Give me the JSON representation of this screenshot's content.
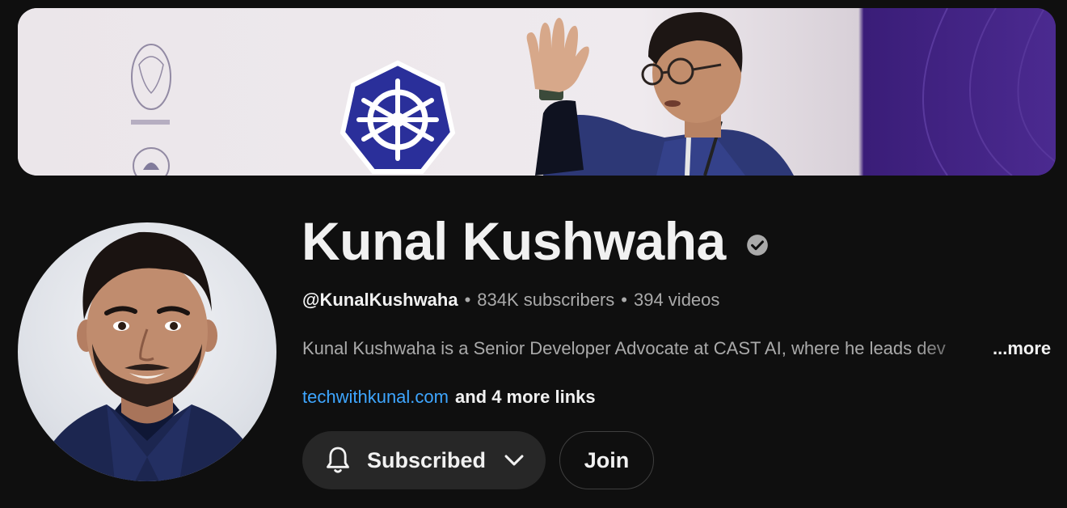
{
  "channel": {
    "name": "Kunal Kushwaha",
    "handle": "@KunalKushwaha",
    "subscribers": "834K subscribers",
    "videos": "394 videos",
    "separator": "•",
    "description": "Kunal Kushwaha is a Senior Developer Advocate at CAST AI, where he leads dev",
    "more_label": "...more",
    "link_primary": "techwithkunal.com",
    "link_more": "and 4 more links"
  },
  "actions": {
    "subscribed_label": "Subscribed",
    "join_label": "Join"
  },
  "colors": {
    "background": "#0f0f0f",
    "button_bg": "#272727",
    "link": "#3ea6ff",
    "muted_text": "#aaaaaa"
  },
  "icons": {
    "verified": "verified-check-icon",
    "bell": "bell-icon",
    "chevron": "chevron-down-icon"
  }
}
